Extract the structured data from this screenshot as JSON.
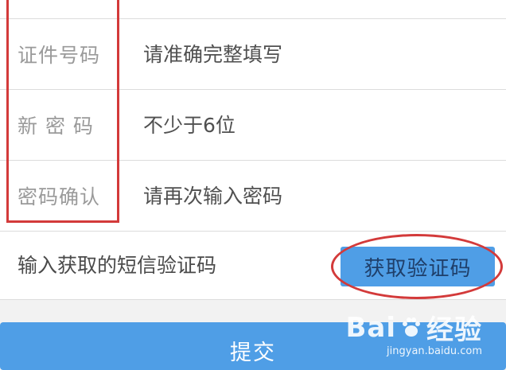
{
  "form": {
    "id_number": {
      "label": "证件号码",
      "placeholder": "请准确完整填写"
    },
    "new_password": {
      "label": "新 密 码",
      "placeholder": "不少于6位"
    },
    "confirm_password": {
      "label": "密码确认",
      "placeholder": "请再次输入密码"
    },
    "sms_code": {
      "placeholder": "输入获取的短信验证码",
      "button": "获取验证码"
    }
  },
  "submit": {
    "label": "提交"
  },
  "watermark": {
    "brand": "Bai",
    "suffix": "经验",
    "url": "jingyan.baidu.com"
  },
  "colors": {
    "accent": "#4f9ee6",
    "annotation": "#d33a3a",
    "divider": "#dcdcdc"
  },
  "icons": {
    "watermark_logo": "baidu-paw-icon"
  }
}
